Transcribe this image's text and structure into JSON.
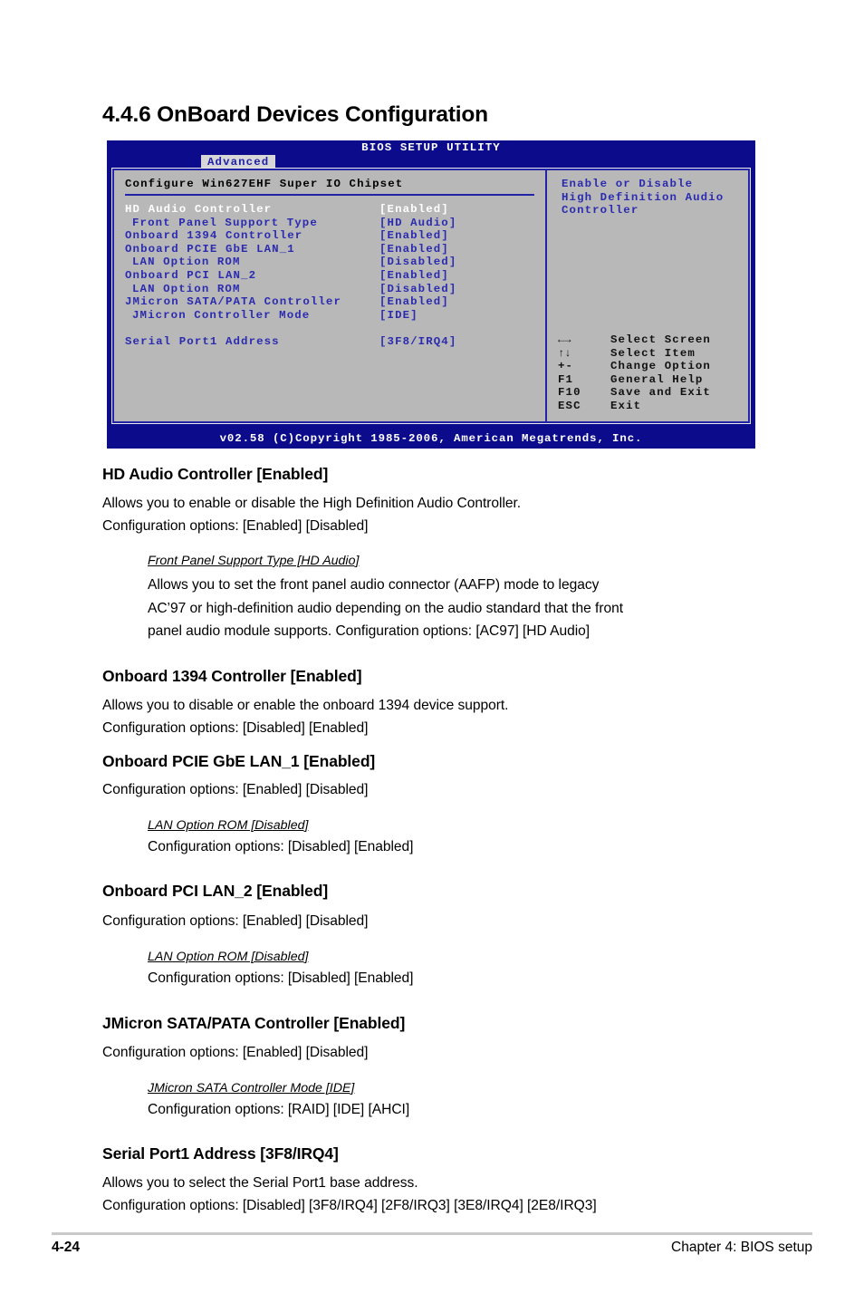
{
  "page": {
    "heading": "4.4.6 OnBoard Devices Configuration",
    "footer_page_number": "4-24",
    "footer_chapter": "Chapter 4: BIOS setup"
  },
  "bios": {
    "title": "BIOS SETUP UTILITY",
    "active_tab": "Advanced",
    "section_title": "Configure Win627EHF Super IO Chipset",
    "rows": [
      {
        "label": "HD Audio Controller",
        "value": "[Enabled]",
        "selected": true,
        "indent": false
      },
      {
        "label": "Front Panel Support Type",
        "value": "[HD Audio]",
        "selected": false,
        "indent": true
      },
      {
        "label": "Onboard 1394 Controller",
        "value": "[Enabled]",
        "selected": false,
        "indent": false
      },
      {
        "label": "Onboard PCIE GbE LAN_1",
        "value": "[Enabled]",
        "selected": false,
        "indent": false
      },
      {
        "label": "LAN Option ROM",
        "value": "[Disabled]",
        "selected": false,
        "indent": true
      },
      {
        "label": "Onboard PCI LAN_2",
        "value": "[Enabled]",
        "selected": false,
        "indent": false
      },
      {
        "label": "LAN Option ROM",
        "value": "[Disabled]",
        "selected": false,
        "indent": true
      },
      {
        "label": "JMicron SATA/PATA Controller",
        "value": "[Enabled]",
        "selected": false,
        "indent": false
      },
      {
        "label": "JMicron Controller Mode",
        "value": "[IDE]",
        "selected": false,
        "indent": true
      },
      {
        "label": "",
        "value": "",
        "selected": false,
        "indent": false
      },
      {
        "label": "Serial Port1 Address",
        "value": "[3F8/IRQ4]",
        "selected": false,
        "indent": false
      }
    ],
    "help_lines": [
      "Enable or Disable",
      "High Definition Audio",
      "Controller"
    ],
    "keys": [
      {
        "key": "←→",
        "desc": "Select Screen",
        "glyph": true
      },
      {
        "key": "↑↓",
        "desc": "Select Item",
        "glyph": true
      },
      {
        "key": "+-",
        "desc": "Change Option",
        "glyph": false
      },
      {
        "key": "F1",
        "desc": "General Help",
        "glyph": false
      },
      {
        "key": "F10",
        "desc": "Save and Exit",
        "glyph": false
      },
      {
        "key": "ESC",
        "desc": "Exit",
        "glyph": false
      }
    ],
    "copyright": "v02.58 (C)Copyright 1985-2006, American Megatrends, Inc.",
    "colors": {
      "screen_blue": "#0b0b8c",
      "panel_gray": "#b8b8b8",
      "item_blue": "#2b2bb0",
      "selected_white": "#ffffff"
    }
  },
  "sections": {
    "hd_audio": {
      "heading": "HD Audio Controller [Enabled]",
      "line1": "Allows you to enable or disable the High Definition Audio Controller.",
      "line2": "Configuration options: [Enabled] [Disabled]",
      "sub_heading": "Front Panel Support Type [HD Audio]",
      "sub_line1": "Allows you to set the front panel audio connector (AAFP) mode to legacy",
      "sub_line2": "AC’97 or high-definition audio depending on the audio standard that the front",
      "sub_line3": "panel audio module supports. Configuration options: [AC97] [HD Audio]"
    },
    "onboard_1394": {
      "heading": "Onboard 1394 Controller [Enabled]",
      "line1": "Allows you to disable or enable the onboard 1394 device support.",
      "line2": "Configuration options: [Disabled] [Enabled]"
    },
    "lan_1": {
      "heading": "Onboard PCIE GbE LAN_1 [Enabled]",
      "line1": "Configuration options: [Enabled] [Disabled]",
      "sub_heading": "LAN Option ROM [Disabled]",
      "sub_line1": "Configuration options: [Disabled] [Enabled]"
    },
    "lan_2": {
      "heading": "Onboard PCI LAN_2 [Enabled]",
      "line1": "Configuration options: [Enabled] [Disabled]",
      "sub_heading": "LAN Option ROM [Disabled]",
      "sub_line1": "Configuration options: [Disabled] [Enabled]"
    },
    "jmicron": {
      "heading": "JMicron SATA/PATA Controller [Enabled]",
      "line1": "Configuration options: [Enabled] [Disabled]",
      "sub_heading": "JMicron SATA Controller Mode [IDE]",
      "sub_line1": "Configuration options: [RAID] [IDE] [AHCI]"
    },
    "serial_port": {
      "heading": "Serial Port1 Address [3F8/IRQ4]",
      "line1": "Allows you to select the Serial Port1 base address.",
      "line2": "Configuration options: [Disabled] [3F8/IRQ4] [2F8/IRQ3] [3E8/IRQ4] [2E8/IRQ3]"
    }
  }
}
